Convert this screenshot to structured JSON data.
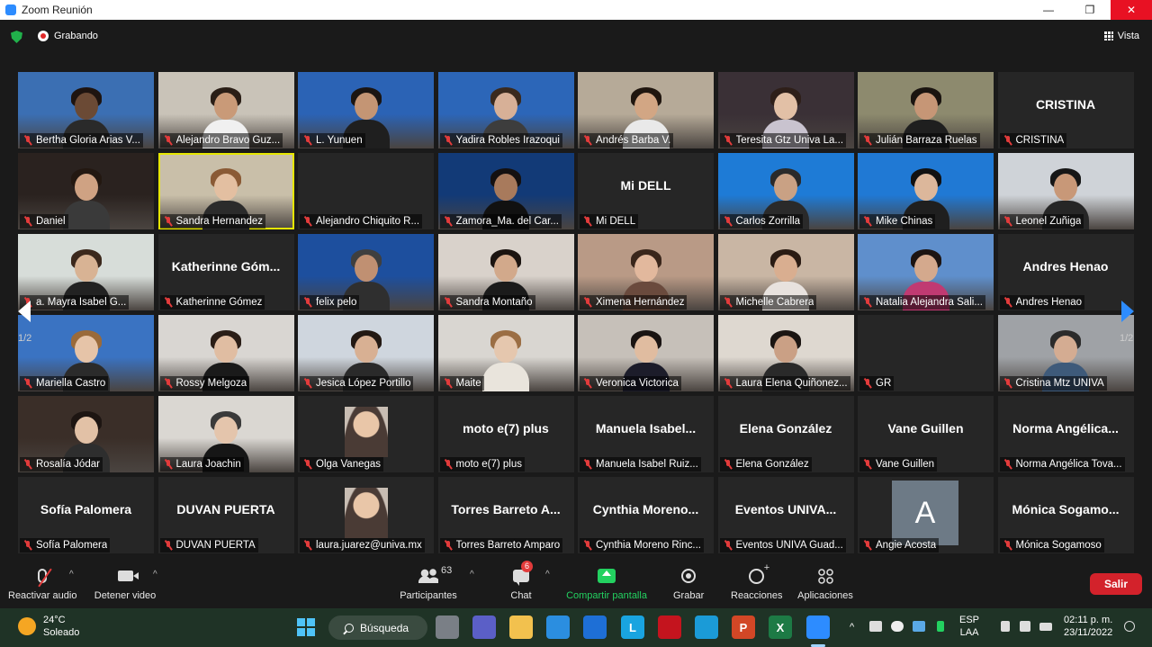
{
  "window": {
    "title": "Zoom Reunión",
    "minimize": "—",
    "maximize": "❐",
    "close": "✕"
  },
  "meeting": {
    "recording_label": "Grabando",
    "view_label": "Vista"
  },
  "pagination": {
    "left_page": "1/2",
    "right_page": "1/2"
  },
  "tiles": [
    {
      "name": "Bertha Gloria Arias V...",
      "kind": "video",
      "bg": "#3b6fb3",
      "skin": "#6b4a35",
      "hair": "#1e1410",
      "shirt": "#2a2a2a"
    },
    {
      "name": "Alejandro Bravo Guz...",
      "kind": "video",
      "bg": "#c9c3b8",
      "skin": "#c99a78",
      "hair": "#2a1e16",
      "shirt": "#f0f0f0"
    },
    {
      "name": "L. Yunuen",
      "kind": "video",
      "bg": "#2b63b5",
      "skin": "#c49574",
      "hair": "#1b1512",
      "shirt": "#1f1f1f"
    },
    {
      "name": "Yadira Robles Irazoqui",
      "kind": "video",
      "bg": "#2c66b8",
      "skin": "#d7b097",
      "hair": "#3a2a1e",
      "shirt": "#3d3d3d"
    },
    {
      "name": "Andrés Barba V.",
      "kind": "video",
      "bg": "#b6aa98",
      "skin": "#d2a684",
      "hair": "#20160f",
      "shirt": "#e9e9e9"
    },
    {
      "name": "Teresita Gtz Univa La...",
      "kind": "video",
      "bg": "#3a3036",
      "skin": "#e2c0a6",
      "hair": "#2e1f19",
      "shirt": "#c9c3cf"
    },
    {
      "name": "Julián Barraza Ruelas",
      "kind": "video",
      "bg": "#8d8a6e",
      "skin": "#c69676",
      "hair": "#1a1410",
      "shirt": "#1f1f1f"
    },
    {
      "name": "CRISTINA",
      "kind": "name",
      "big": "CRISTINA"
    },
    {
      "name": "Daniel",
      "kind": "video",
      "bg": "#2a221f",
      "skin": "#cfa283",
      "hair": "#231811",
      "shirt": "#3a3a3a"
    },
    {
      "name": "Sandra Hernandez",
      "kind": "video",
      "bg": "#c9bfa9",
      "skin": "#e3bfa1",
      "hair": "#8a5a35",
      "shirt": "#2b2b2b",
      "speaker": true
    },
    {
      "name": "Alejandro Chiquito R...",
      "kind": "name",
      "big": ""
    },
    {
      "name": "Zamora_Ma. del Car...",
      "kind": "video",
      "bg": "#123a77",
      "skin": "#a87a5c",
      "hair": "#141010",
      "shirt": "#111111"
    },
    {
      "name": "Mi DELL",
      "kind": "name",
      "big": "Mi DELL"
    },
    {
      "name": "Carlos Zorrilla",
      "kind": "video",
      "bg": "#1e7bd6",
      "skin": "#c9a184",
      "hair": "#2a2a2a",
      "shirt": "#2a2a2a"
    },
    {
      "name": "Mike Chinas",
      "kind": "video",
      "bg": "#2079d4",
      "skin": "#dcb79b",
      "hair": "#111111",
      "shirt": "#1f1f1f"
    },
    {
      "name": "Leonel Zuñiga",
      "kind": "video",
      "bg": "#cfd3d8",
      "skin": "#c89878",
      "hair": "#161616",
      "shirt": "#262626"
    },
    {
      "name": "a. Mayra  Isabel G...",
      "kind": "video",
      "bg": "#d7ddd9",
      "skin": "#d8b394",
      "hair": "#3b281c",
      "shirt": "#222222"
    },
    {
      "name": "Katherinne Gómez",
      "kind": "name",
      "big": "Katherinne  Góm..."
    },
    {
      "name": "felix pelo",
      "kind": "video",
      "bg": "#1d4f9e",
      "skin": "#c09072",
      "hair": "#3f3f3f",
      "shirt": "#2f2f2f"
    },
    {
      "name": "Sandra Montaño",
      "kind": "video",
      "bg": "#d9d2cb",
      "skin": "#d2a98b",
      "hair": "#1b1410",
      "shirt": "#1b1b1b"
    },
    {
      "name": "Ximena Hernández",
      "kind": "video",
      "bg": "#b99a86",
      "skin": "#e2b89d",
      "hair": "#3a261b",
      "shirt": "#6a4a3d"
    },
    {
      "name": "Michelle Cabrera",
      "kind": "video",
      "bg": "#c9b6a4",
      "skin": "#d9ae90",
      "hair": "#2a1b13",
      "shirt": "#e8e2de"
    },
    {
      "name": "Natalia Alejandra Sali...",
      "kind": "video",
      "bg": "#5f8fcc",
      "skin": "#d4a98d",
      "hair": "#1c1412",
      "shirt": "#c03a72"
    },
    {
      "name": "Andres Henao",
      "kind": "name",
      "big": "Andres Henao"
    },
    {
      "name": "Mariella Castro",
      "kind": "video",
      "bg": "#3a73c2",
      "skin": "#e6c4a8",
      "hair": "#9a6a3a",
      "shirt": "#2b2b2b"
    },
    {
      "name": "Rossy Melgoza",
      "kind": "video",
      "bg": "#d9d6d2",
      "skin": "#e0bda2",
      "hair": "#2a1d16",
      "shirt": "#1a1a1a"
    },
    {
      "name": "Jesica López Portillo",
      "kind": "video",
      "bg": "#cfd6de",
      "skin": "#d8b093",
      "hair": "#231913",
      "shirt": "#2a2a2a"
    },
    {
      "name": "Maite",
      "kind": "video",
      "bg": "#d9d6d1",
      "skin": "#e5c7ae",
      "hair": "#9b6e44",
      "shirt": "#e9e4dc"
    },
    {
      "name": "Veronica Victorica",
      "kind": "video",
      "bg": "#c6c0b9",
      "skin": "#e0bca0",
      "hair": "#1a1412",
      "shirt": "#1c1c2a"
    },
    {
      "name": "Laura Elena Quiñonez...",
      "kind": "video",
      "bg": "#ded8d0",
      "skin": "#caa085",
      "hair": "#1b1512",
      "shirt": "#2a2a2a"
    },
    {
      "name": "GR",
      "kind": "name",
      "big": ""
    },
    {
      "name": "Cristina Mtz UNIVA",
      "kind": "video",
      "bg": "#9fa2a6",
      "skin": "#d4ac92",
      "hair": "#2b2b2b",
      "shirt": "#3e5a7a"
    },
    {
      "name": "Rosalía Jódar",
      "kind": "video",
      "bg": "#3a2e28",
      "skin": "#e2c1a6",
      "hair": "#1d1512",
      "shirt": "#2e2e2e"
    },
    {
      "name": "Laura Joachin",
      "kind": "video",
      "bg": "#dad7d2",
      "skin": "#e4c5ac",
      "hair": "#3a3a3a",
      "shirt": "#161616"
    },
    {
      "name": "Olga Vanegas",
      "kind": "photo"
    },
    {
      "name": "moto e(7) plus",
      "kind": "name",
      "big": "moto e(7) plus"
    },
    {
      "name": "Manuela   Isabel Ruiz...",
      "kind": "name",
      "big": "Manuela    Isabel..."
    },
    {
      "name": "Elena González",
      "kind": "name",
      "big": "Elena González"
    },
    {
      "name": "Vane Guillen",
      "kind": "name",
      "big": "Vane Guillen"
    },
    {
      "name": "Norma Angélica Tova...",
      "kind": "name",
      "big": "Norma  Angélica..."
    },
    {
      "name": "Sofía Palomera",
      "kind": "name",
      "big": "Sofía Palomera"
    },
    {
      "name": "DUVAN PUERTA",
      "kind": "name",
      "big": "DUVAN PUERTA"
    },
    {
      "name": "laura.juarez@univa.mx",
      "kind": "photo"
    },
    {
      "name": "Torres Barreto Amparo",
      "kind": "name",
      "big": "Torres Barreto A..."
    },
    {
      "name": "Cynthia Moreno Rinc...",
      "kind": "name",
      "big": "Cynthia  Moreno..."
    },
    {
      "name": "Eventos UNIVA Guad...",
      "kind": "name",
      "big": "Eventos  UNIVA..."
    },
    {
      "name": "Angie Acosta",
      "kind": "letter",
      "letter": "A"
    },
    {
      "name": "Mónica Sogamoso",
      "kind": "name",
      "big": "Mónica  Sogamo..."
    }
  ],
  "toolbar": {
    "audio_label": "Reactivar audio",
    "video_label": "Detener video",
    "participants_label": "Participantes",
    "participants_count": "63",
    "chat_label": "Chat",
    "chat_badge": "6",
    "share_label": "Compartir pantalla",
    "record_label": "Grabar",
    "reactions_label": "Reacciones",
    "apps_label": "Aplicaciones",
    "leave_label": "Salir",
    "caret": "^"
  },
  "taskbar": {
    "temperature": "24°C",
    "weather": "Soleado",
    "search_label": "Búsqueda",
    "lang_line1": "ESP",
    "lang_line2": "LAA",
    "time": "02:11 p. m.",
    "date": "23/11/2022",
    "apps": [
      {
        "icon": "task-view-icon",
        "color": "#7a7f86",
        "glyph": ""
      },
      {
        "icon": "teams-icon",
        "color": "#5b5fc7",
        "glyph": ""
      },
      {
        "icon": "file-explorer-icon",
        "color": "#f2c14e",
        "glyph": ""
      },
      {
        "icon": "store-icon",
        "color": "#2b8ee0",
        "glyph": ""
      },
      {
        "icon": "mail-icon",
        "color": "#1e6fd6",
        "glyph": ""
      },
      {
        "icon": "l-app-icon",
        "color": "#19a4e0",
        "glyph": "L"
      },
      {
        "icon": "mcafee-icon",
        "color": "#c4141e",
        "glyph": ""
      },
      {
        "icon": "edge-icon",
        "color": "#1b9bd7",
        "glyph": ""
      },
      {
        "icon": "powerpoint-icon",
        "color": "#d24726",
        "glyph": "P"
      },
      {
        "icon": "excel-icon",
        "color": "#1d7a45",
        "glyph": "X"
      },
      {
        "icon": "zoom-icon",
        "color": "#2d8cff",
        "glyph": ""
      }
    ]
  },
  "colors": {
    "accent": "#2d8cff",
    "record_red": "#e02828",
    "leave_red": "#d3222b",
    "share_green": "#23d160",
    "speaker_border": "#e6e600"
  }
}
